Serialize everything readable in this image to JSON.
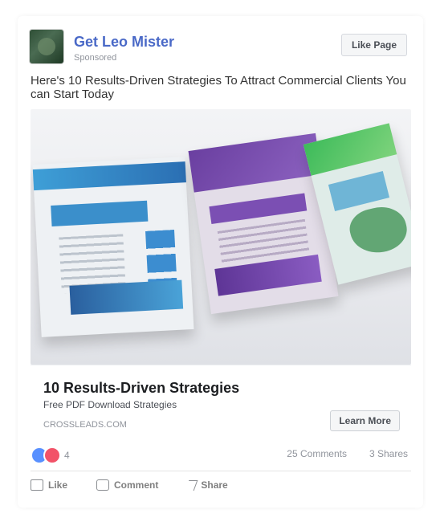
{
  "post": {
    "page_name": "Get Leo Mister",
    "sponsored_label": "Sponsored",
    "follow_label": "Like Page",
    "body_text": "Here's 10 Results-Driven Strategies To Attract Commercial Clients You can Start Today"
  },
  "creative": {
    "brochure_colors": [
      "#2b6fb3",
      "#6a3fa0",
      "#3dbb5a"
    ]
  },
  "cta": {
    "title": "10 Results-Driven Strategies",
    "description": "Free PDF Download Strategies",
    "url": "CROSSLEADS.COM",
    "button_label": "Learn More"
  },
  "stats": {
    "reactions_count": "4",
    "comments": "25 Comments",
    "shares": "3 Shares"
  },
  "actions": {
    "like": "Like",
    "comment": "Comment",
    "share": "Share"
  }
}
